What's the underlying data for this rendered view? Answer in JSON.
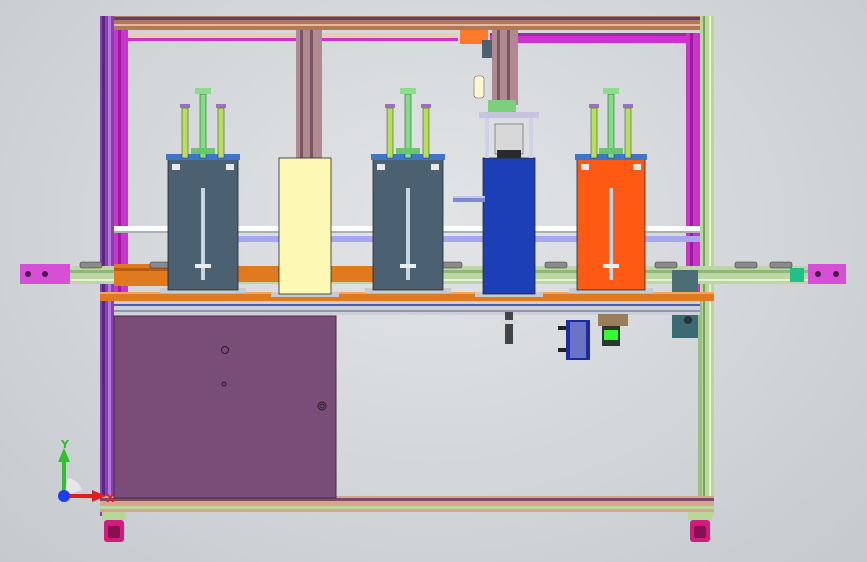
{
  "viewport": {
    "background": "#d6d9dc"
  },
  "triad": {
    "x_label": "X",
    "y_label": "Y",
    "x_color": "#e01e1e",
    "y_color": "#2fbf2f",
    "z_color": "#1a3cff"
  },
  "colors": {
    "frame_purple": "#8b3fb5",
    "frame_magenta": "#cc33cc",
    "frame_green": "#b7d89a",
    "frame_tan": "#e6c3a4",
    "plate_orange": "#e07a1f",
    "panel_purple": "#7a4c78",
    "module_slate": "#4b6070",
    "module_cream": "#fdf8b4",
    "module_blue": "#1c3fb8",
    "module_orange": "#ff5a14",
    "conveyor_magenta": "#d64fd6",
    "caster_magenta": "#d01c7c"
  },
  "modules": [
    {
      "name": "cylinder-module-1",
      "color_key": "module_slate"
    },
    {
      "name": "cover-module",
      "color_key": "module_cream"
    },
    {
      "name": "cylinder-module-2",
      "color_key": "module_slate"
    },
    {
      "name": "press-module",
      "color_key": "module_blue"
    },
    {
      "name": "cylinder-module-3",
      "color_key": "module_orange"
    }
  ]
}
